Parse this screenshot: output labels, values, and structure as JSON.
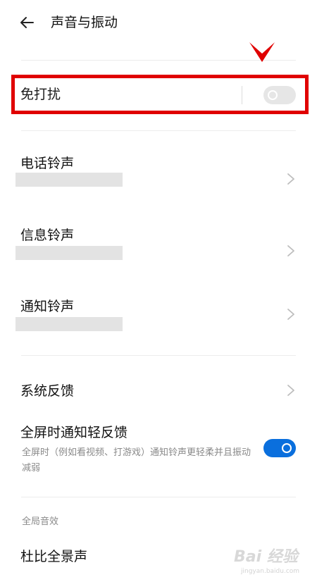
{
  "header": {
    "title": "声音与振动",
    "back_icon": "back-arrow-icon"
  },
  "dnd": {
    "label": "免打扰",
    "toggle_state": "off"
  },
  "ringtones": [
    {
      "label": "电话铃声",
      "chevron": "chevron-right-icon"
    },
    {
      "label": "信息铃声",
      "chevron": "chevron-right-icon"
    },
    {
      "label": "通知铃声",
      "chevron": "chevron-right-icon"
    }
  ],
  "system_feedback": {
    "label": "系统反馈"
  },
  "fullscreen": {
    "label": "全屏时通知轻反馈",
    "description": "全屏时（例如看视频、打游戏）通知铃声更轻柔并且振动减弱",
    "toggle_state": "on"
  },
  "global_section": {
    "header": "全局音效",
    "item_label": "杜比全景声"
  },
  "watermark": {
    "text": "Bai 经验",
    "sub": "jingyan.baidu.com"
  },
  "colors": {
    "highlight": "#e00000",
    "accent": "#0a6fdd"
  }
}
